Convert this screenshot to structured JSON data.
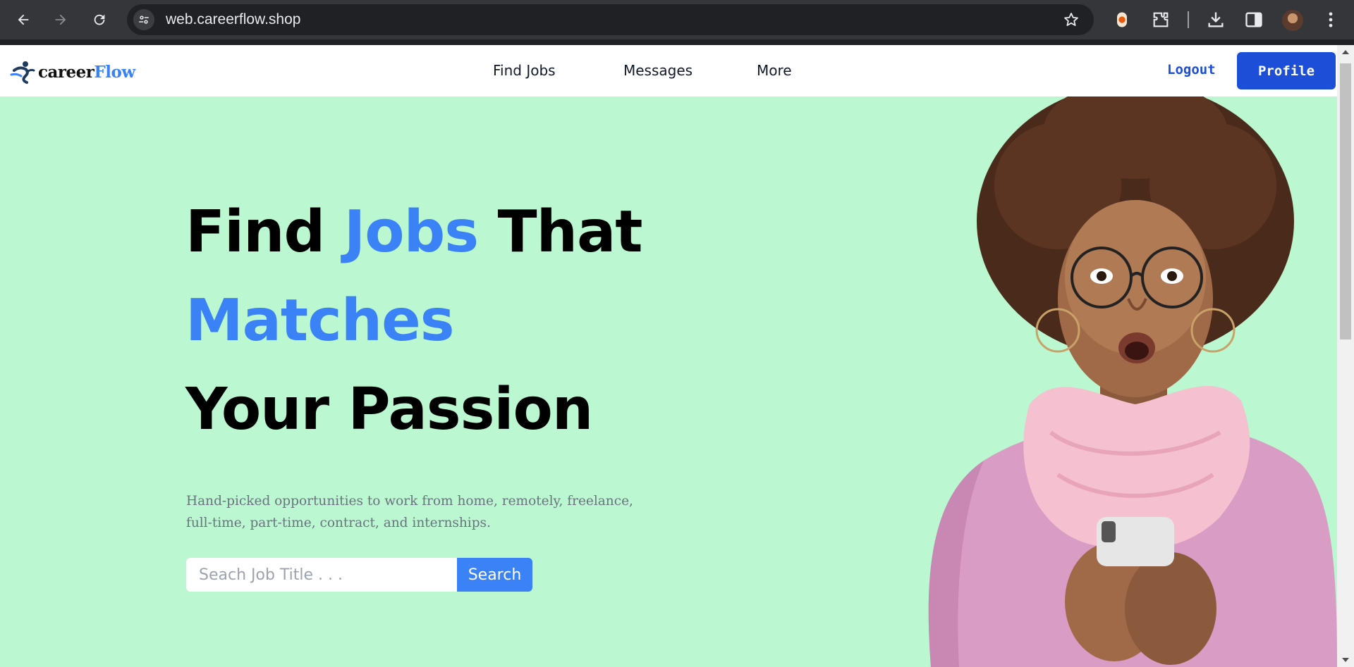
{
  "browser": {
    "url": "web.careerflow.shop",
    "icons": [
      "back-arrow-icon",
      "forward-arrow-icon",
      "reload-icon",
      "site-settings-icon",
      "bookmark-star-icon",
      "extension-record-icon",
      "extensions-puzzle-icon",
      "download-icon",
      "side-panel-icon",
      "profile-avatar",
      "menu-dots-icon"
    ]
  },
  "header": {
    "logo_career": "career",
    "logo_flow": "Flow",
    "nav": [
      "Find Jobs",
      "Messages",
      "More"
    ],
    "logout_label": "Logout",
    "profile_label": "Profile"
  },
  "hero": {
    "line1_a": "Find ",
    "line1_b": "Jobs",
    "line1_c": " That",
    "line2": "Matches",
    "line3": "Your Passion",
    "subtitle": "Hand-picked opportunities to work from home, remotely, freelance, full-time, part-time, contract, and internships.",
    "search_placeholder": "Seach Job Title . . .",
    "search_button": "Search"
  },
  "colors": {
    "hero_bg": "#bbf7d0",
    "accent_blue": "#3b82f6",
    "button_blue": "#1d4ed8"
  }
}
